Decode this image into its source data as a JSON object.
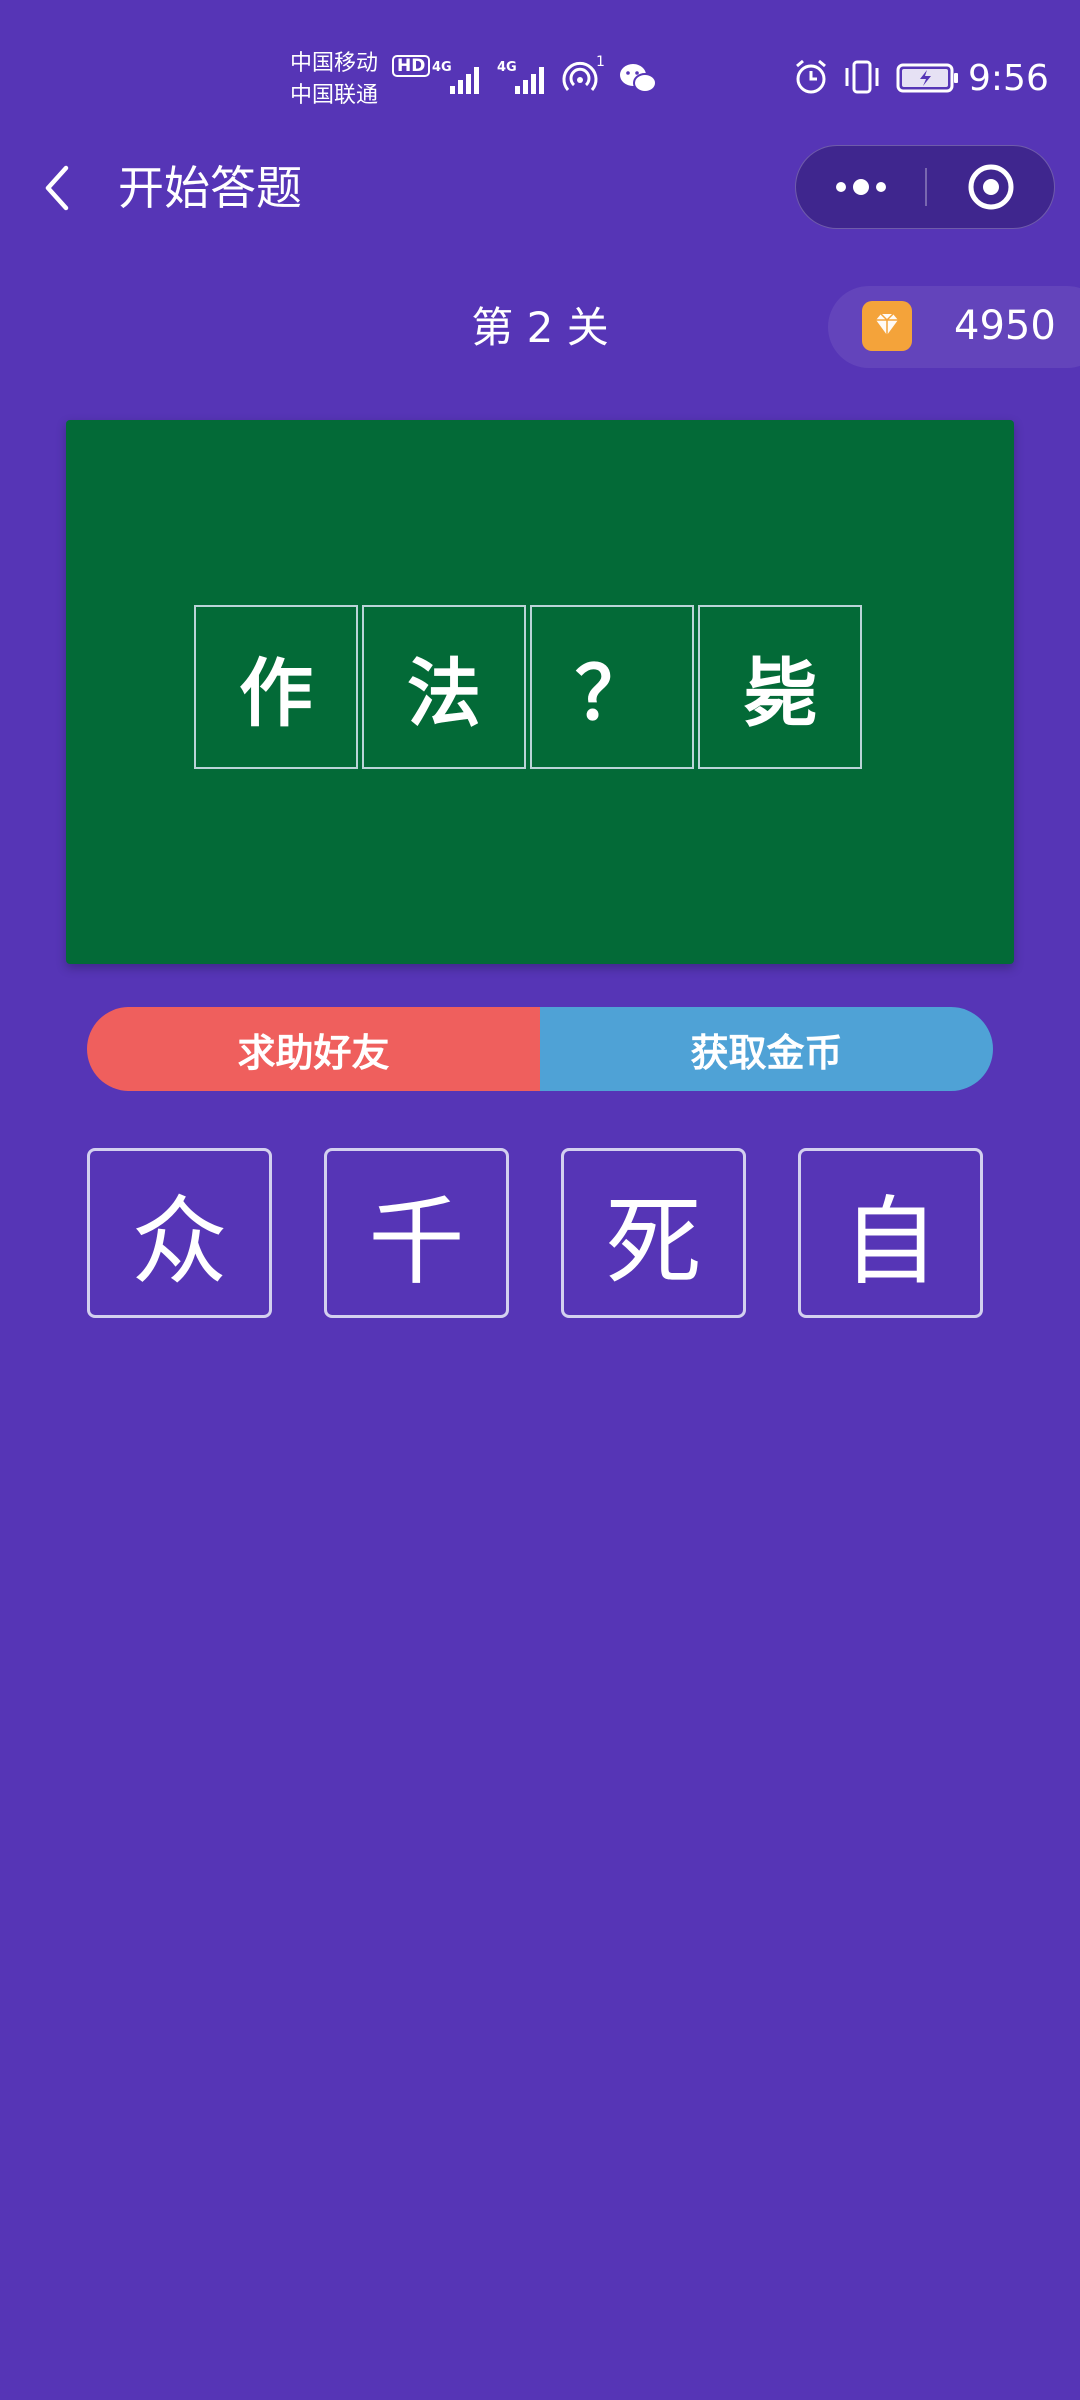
{
  "status_bar": {
    "carrier1": "中国移动",
    "carrier2": "中国联通",
    "hd_badge": "HD",
    "net1": "4G",
    "net2": "4G",
    "hotspot_count": "1",
    "time": "9:56",
    "icons": [
      "signal-icon",
      "hotspot-icon",
      "wechat-icon",
      "alarm-icon",
      "vibrate-icon",
      "battery-icon"
    ]
  },
  "nav": {
    "title": "开始答题",
    "back_icon": "chevron-left-icon",
    "more_icon": "more-dots-icon",
    "close_icon": "target-circle-icon"
  },
  "level": {
    "label": "第 2 关"
  },
  "coins": {
    "icon": "diamond-icon",
    "count": "4950"
  },
  "puzzle": {
    "cells": [
      "作",
      "法",
      "？",
      "毙"
    ]
  },
  "actions": {
    "help_label": "求助好友",
    "get_coins_label": "获取金币"
  },
  "options": [
    "众",
    "千",
    "死",
    "自"
  ],
  "colors": {
    "background": "#5635b6",
    "board": "#036a37",
    "help_button": "#ef5f5d",
    "coins_button": "#4fa2d6",
    "coin_icon": "#f4a33a"
  }
}
